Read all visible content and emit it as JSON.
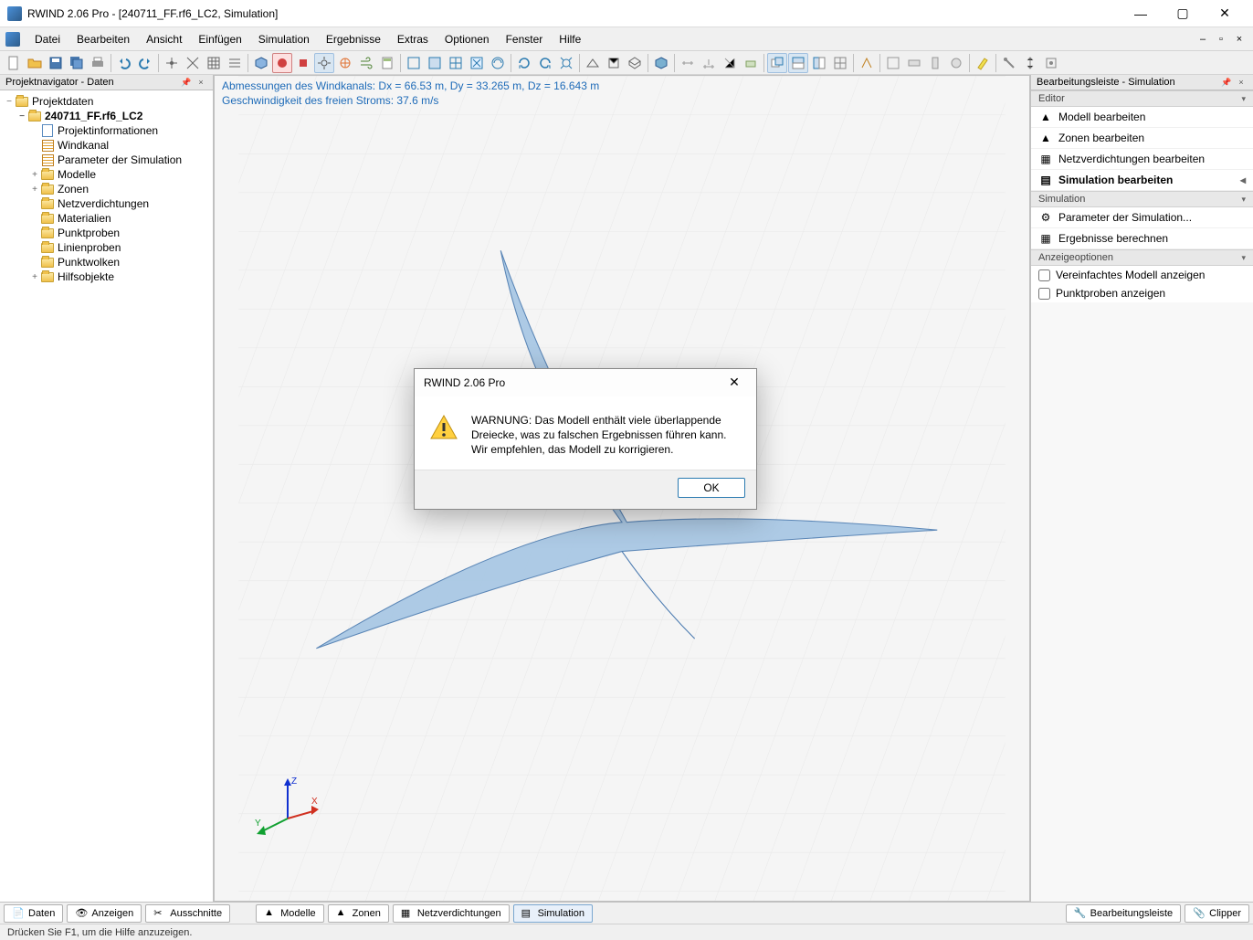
{
  "window": {
    "title": "RWIND 2.06 Pro - [240711_FF.rf6_LC2, Simulation]"
  },
  "menu": {
    "items": [
      "Datei",
      "Bearbeiten",
      "Ansicht",
      "Einfügen",
      "Simulation",
      "Ergebnisse",
      "Extras",
      "Optionen",
      "Fenster",
      "Hilfe"
    ]
  },
  "left_panel": {
    "title": "Projektnavigator - Daten",
    "tree": {
      "root": "Projektdaten",
      "project": "240711_FF.rf6_LC2",
      "items": [
        "Projektinformationen",
        "Windkanal",
        "Parameter der Simulation",
        "Modelle",
        "Zonen",
        "Netzverdichtungen",
        "Materialien",
        "Punktproben",
        "Linienproben",
        "Punktwolken",
        "Hilfsobjekte"
      ]
    }
  },
  "viewport": {
    "line1": "Abmessungen des Windkanals: Dx = 66.53 m, Dy = 33.265 m, Dz = 16.643 m",
    "line2": "Geschwindigkeit des freien Stroms: 37.6 m/s",
    "axis": {
      "x": "X",
      "y": "Y",
      "z": "Z"
    }
  },
  "right_panel": {
    "title": "Bearbeitungsleiste - Simulation",
    "sections": {
      "editor": "Editor",
      "simulation": "Simulation",
      "display": "Anzeigeoptionen"
    },
    "editor_items": [
      "Modell bearbeiten",
      "Zonen bearbeiten",
      "Netzverdichtungen bearbeiten",
      "Simulation bearbeiten"
    ],
    "sim_items": [
      "Parameter der Simulation...",
      "Ergebnisse berechnen"
    ],
    "display_items": [
      "Vereinfachtes Modell anzeigen",
      "Punktproben anzeigen"
    ]
  },
  "bottom_tabs": {
    "left": [
      "Daten",
      "Anzeigen",
      "Ausschnitte"
    ],
    "center": [
      "Modelle",
      "Zonen",
      "Netzverdichtungen",
      "Simulation"
    ],
    "right": [
      "Bearbeitungsleiste",
      "Clipper"
    ]
  },
  "statusbar": {
    "text": "Drücken Sie F1, um die Hilfe anzuzeigen."
  },
  "dialog": {
    "title": "RWIND 2.06 Pro",
    "message": "WARNUNG: Das Modell enthält viele überlappende Dreiecke, was zu falschen Ergebnissen führen kann. Wir empfehlen, das Modell zu korrigieren.",
    "ok": "OK"
  }
}
